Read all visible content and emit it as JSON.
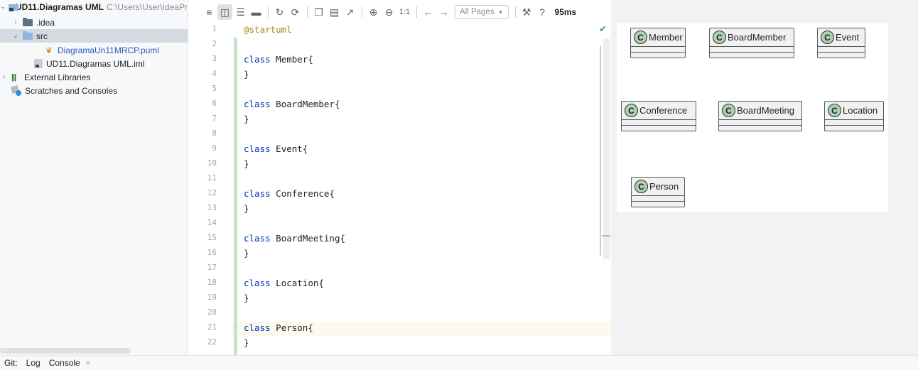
{
  "project_tree": {
    "root": {
      "name": "UD11.Diagramas UML",
      "path": "C:\\Users\\User\\IdeaPr"
    },
    "items": [
      {
        "label": ".idea"
      },
      {
        "label": "src"
      },
      {
        "label": "DiagramaUn11MRCP.puml"
      },
      {
        "label": "UD11.Diagramas UML.iml"
      },
      {
        "label": "External Libraries"
      },
      {
        "label": "Scratches and Consoles"
      }
    ]
  },
  "toolbar": {
    "zoom_actual": "1:1",
    "pages_select": "All Pages",
    "render_time": "95ms",
    "help": "?"
  },
  "editor": {
    "line_numbers": [
      "1",
      "2",
      "3",
      "4",
      "5",
      "6",
      "7",
      "8",
      "9",
      "10",
      "11",
      "12",
      "13",
      "14",
      "15",
      "16",
      "17",
      "18",
      "19",
      "20",
      "21",
      "22"
    ],
    "lines": [
      {
        "kw": "",
        "text": "@startuml",
        "type": "meta"
      },
      {
        "kw": "",
        "text": "",
        "type": "plain"
      },
      {
        "kw": "class",
        "text": " Member{",
        "type": "class"
      },
      {
        "kw": "",
        "text": "}",
        "type": "plain"
      },
      {
        "kw": "",
        "text": "",
        "type": "plain"
      },
      {
        "kw": "class",
        "text": " BoardMember{",
        "type": "class"
      },
      {
        "kw": "",
        "text": "}",
        "type": "plain"
      },
      {
        "kw": "",
        "text": "",
        "type": "plain"
      },
      {
        "kw": "class",
        "text": " Event{",
        "type": "class"
      },
      {
        "kw": "",
        "text": "}",
        "type": "plain"
      },
      {
        "kw": "",
        "text": "",
        "type": "plain"
      },
      {
        "kw": "class",
        "text": " Conference{",
        "type": "class"
      },
      {
        "kw": "",
        "text": "}",
        "type": "plain"
      },
      {
        "kw": "",
        "text": "",
        "type": "plain"
      },
      {
        "kw": "class",
        "text": " BoardMeeting{",
        "type": "class"
      },
      {
        "kw": "",
        "text": "}",
        "type": "plain"
      },
      {
        "kw": "",
        "text": "",
        "type": "plain"
      },
      {
        "kw": "class",
        "text": " Location{",
        "type": "class"
      },
      {
        "kw": "",
        "text": "}",
        "type": "plain"
      },
      {
        "kw": "",
        "text": "",
        "type": "plain"
      },
      {
        "kw": "class",
        "text": " Person{",
        "type": "class"
      },
      {
        "kw": "",
        "text": "}",
        "type": "plain"
      }
    ]
  },
  "diagram": {
    "badge_letter": "C",
    "classes": [
      "Member",
      "BoardMember",
      "Event",
      "Conference",
      "BoardMeeting",
      "Location",
      "Person"
    ]
  },
  "bottom_bar": {
    "git": "Git:",
    "log": "Log",
    "console": "Console",
    "close": "×"
  },
  "colors": {
    "keyword": "#0033b3",
    "annotation": "#9e880d",
    "class_badge": "#add1b2",
    "change_bar": "#c9e3c9"
  }
}
